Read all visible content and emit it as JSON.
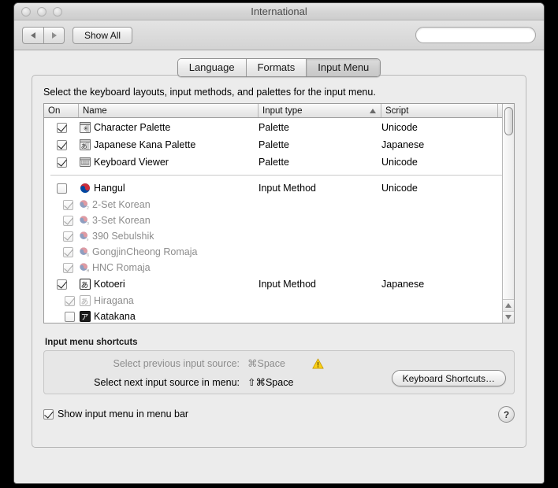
{
  "window": {
    "title": "International",
    "traffic_lights": [
      "close",
      "minimize",
      "zoom"
    ]
  },
  "toolbar": {
    "back_label": "◀",
    "forward_label": "▶",
    "show_all_label": "Show All",
    "search_placeholder": "",
    "search_value": "",
    "search_icon": "search-icon"
  },
  "tabs": [
    {
      "label": "Language",
      "active": false
    },
    {
      "label": "Formats",
      "active": false
    },
    {
      "label": "Input Menu",
      "active": true
    }
  ],
  "content": {
    "instruction": "Select the keyboard layouts, input methods, and palettes for the input menu."
  },
  "table": {
    "columns": [
      {
        "key": "on",
        "label": "On"
      },
      {
        "key": "name",
        "label": "Name"
      },
      {
        "key": "type",
        "label": "Input type",
        "sorted": true,
        "sort_direction": "ascending"
      },
      {
        "key": "script",
        "label": "Script"
      }
    ],
    "rows": [
      {
        "level": 0,
        "checked": true,
        "enabled": true,
        "icon": "character-palette-icon",
        "name": "Character Palette",
        "type": "Palette",
        "script": "Unicode"
      },
      {
        "level": 0,
        "checked": true,
        "enabled": true,
        "icon": "kana-palette-icon",
        "name": "Japanese Kana Palette",
        "type": "Palette",
        "script": "Japanese"
      },
      {
        "level": 0,
        "checked": true,
        "enabled": true,
        "icon": "keyboard-viewer-icon",
        "name": "Keyboard Viewer",
        "type": "Palette",
        "script": "Unicode"
      },
      {
        "separator": true
      },
      {
        "level": 0,
        "checked": false,
        "enabled": true,
        "icon": "hangul-icon",
        "name": "Hangul",
        "type": "Input Method",
        "script": "Unicode"
      },
      {
        "level": 1,
        "checked": true,
        "enabled": false,
        "icon": "taegeuk-icon-2",
        "name": "2-Set Korean",
        "type": "",
        "script": ""
      },
      {
        "level": 1,
        "checked": true,
        "enabled": false,
        "icon": "taegeuk-icon-3",
        "name": "3-Set Korean",
        "type": "",
        "script": ""
      },
      {
        "level": 1,
        "checked": true,
        "enabled": false,
        "icon": "taegeuk-icon-s",
        "name": "390 Sebulshik",
        "type": "",
        "script": ""
      },
      {
        "level": 1,
        "checked": true,
        "enabled": false,
        "icon": "taegeuk-icon-g",
        "name": "GongjinCheong Romaja",
        "type": "",
        "script": ""
      },
      {
        "level": 1,
        "checked": true,
        "enabled": false,
        "icon": "taegeuk-icon-h",
        "name": "HNC Romaja",
        "type": "",
        "script": ""
      },
      {
        "level": 0,
        "checked": true,
        "enabled": true,
        "icon": "kotoeri-icon",
        "name": "Kotoeri",
        "type": "Input Method",
        "script": "Japanese"
      },
      {
        "level": 1,
        "checked": true,
        "enabled": false,
        "icon": "hiragana-icon",
        "name": "Hiragana",
        "type": "",
        "script": ""
      },
      {
        "level": 1,
        "checked": false,
        "enabled": true,
        "icon": "katakana-icon",
        "name": "Katakana",
        "type": "",
        "script": ""
      }
    ]
  },
  "shortcuts": {
    "group_label": "Input menu shortcuts",
    "rows": [
      {
        "label": "Select previous input source:",
        "key": "⌘Space",
        "enabled": false,
        "warning": true
      },
      {
        "label": "Select next input source in menu:",
        "key": "⇧⌘Space",
        "enabled": true,
        "warning": false
      }
    ],
    "warning_icon": "warning-triangle-icon",
    "button_label": "Keyboard Shortcuts…"
  },
  "footer": {
    "show_menu_checkbox_checked": true,
    "show_menu_label": "Show input menu in menu bar",
    "help_label": "?"
  },
  "colors": {
    "window_bg": "#ececec",
    "titlebar_top": "#e8e8e8",
    "table_bg": "#ffffff",
    "warning_yellow": "#fcd116",
    "korea_red": "#cd2e3a",
    "korea_blue": "#0047a0",
    "disabled_text": "#8d8d8d"
  }
}
